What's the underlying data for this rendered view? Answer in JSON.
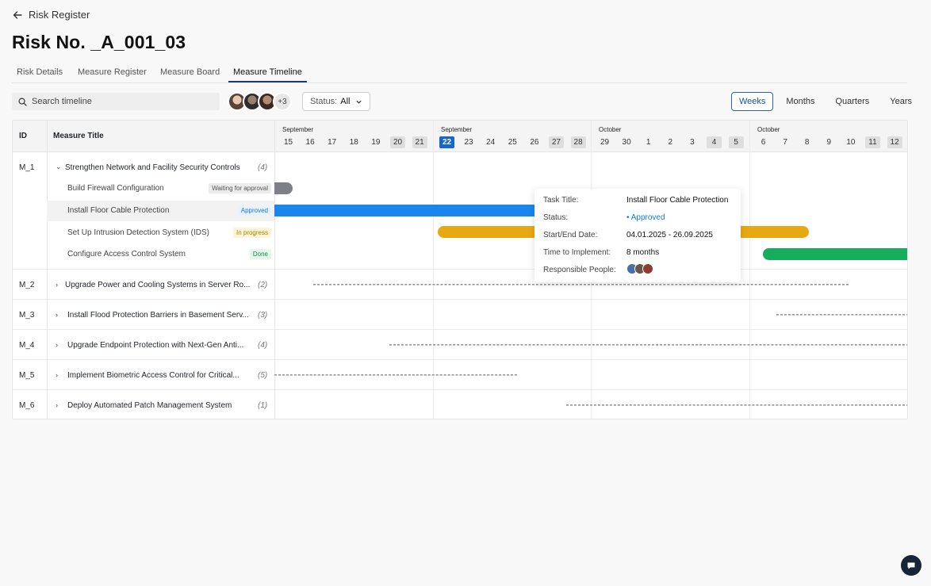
{
  "header": {
    "back_label": "Risk Register",
    "title": "Risk No. _A_001_03"
  },
  "tabs": [
    {
      "label": "Risk Details",
      "active": false
    },
    {
      "label": "Measure Register",
      "active": false
    },
    {
      "label": "Measure Board",
      "active": false
    },
    {
      "label": "Measure Timeline",
      "active": true
    }
  ],
  "toolbar": {
    "search_placeholder": "Search timeline",
    "avatars_more": "+3",
    "status_label": "Status:",
    "status_value": "All",
    "scales": [
      "Weeks",
      "Months",
      "Quarters",
      "Years"
    ],
    "active_scale": "Weeks"
  },
  "grid": {
    "col_id": "ID",
    "col_title": "Measure Title",
    "months": [
      "September",
      "September",
      "October",
      "October"
    ],
    "days": [
      "15",
      "16",
      "17",
      "18",
      "19",
      "20",
      "21",
      "22",
      "23",
      "24",
      "25",
      "26",
      "27",
      "28",
      "29",
      "30",
      "1",
      "2",
      "3",
      "4",
      "5",
      "6",
      "7",
      "8",
      "9",
      "10",
      "11",
      "12"
    ],
    "weekend_days": [
      "20",
      "21",
      "27",
      "28",
      "4",
      "5",
      "11",
      "12"
    ],
    "today": "22"
  },
  "measures": [
    {
      "id": "M_1",
      "title": "Strengthen Network and Facility Security Controls",
      "count": "(4)",
      "expanded": true,
      "tasks": [
        {
          "title": "Build Firewall Configuration",
          "status": "Waiting for approval"
        },
        {
          "title": "Install Floor Cable Protection",
          "status": "Approved"
        },
        {
          "title": "Set Up Intrusion Detection System (IDS)",
          "status": "In progress"
        },
        {
          "title": "Configure Access Control System",
          "status": "Done"
        }
      ]
    },
    {
      "id": "M_2",
      "title": "Upgrade Power and Cooling Systems in Server Ro...",
      "count": "(2)",
      "expanded": false
    },
    {
      "id": "M_3",
      "title": "Install Flood Protection Barriers in Basement Serv...",
      "count": "(3)",
      "expanded": false
    },
    {
      "id": "M_4",
      "title": "Upgrade Endpoint Protection with Next-Gen Anti...",
      "count": "(4)",
      "expanded": false
    },
    {
      "id": "M_5",
      "title": "Implement Biometric Access Control for Critical...",
      "count": "(5)",
      "expanded": false
    },
    {
      "id": "M_6",
      "title": "Deploy Automated Patch Management System",
      "count": "(1)",
      "expanded": false
    }
  ],
  "tooltip": {
    "task_title_label": "Task Title:",
    "task_title": "Install Floor Cable Protection",
    "status_label": "Status:",
    "status": "Approved",
    "dates_label": "Start/End Date:",
    "dates": "04.01.2025 - 26.09.2025",
    "time_label": "Time to Implement:",
    "time": "8 months",
    "people_label": "Responsible People:"
  },
  "colors": {
    "waiting": "#7d8187",
    "approved": "#1a86ec",
    "in_progress": "#e7a912",
    "done": "#16ad5c",
    "accent": "#1668c6"
  }
}
